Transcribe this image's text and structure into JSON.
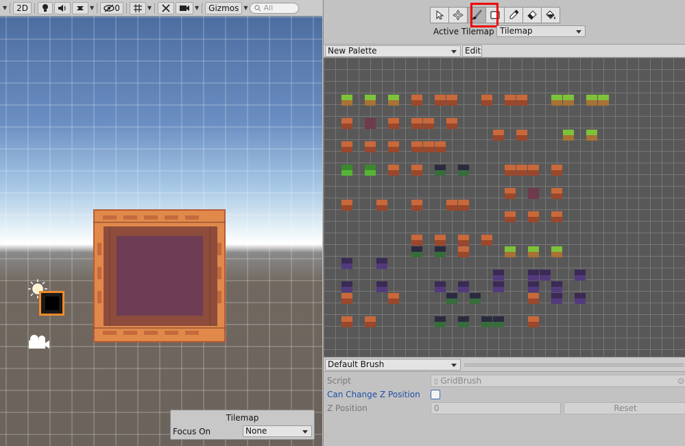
{
  "scene": {
    "toolbar": {
      "mode_2d_label": "2D",
      "hidden_count": "0",
      "gizmos_label": "Gizmos",
      "search_placeholder": "All",
      "icons": [
        "lightbulb-icon",
        "audio-icon",
        "effects-icon",
        "visibility-icon",
        "grid-icon",
        "tools-icon",
        "camera-icon"
      ]
    },
    "colors": {
      "sky_top": "#4d6da0",
      "ground": "#6a625b",
      "frame_orange": "#e0894a",
      "frame_interior": "#6e3c55"
    }
  },
  "tilemap_overlay": {
    "title": "Tilemap",
    "focus_label": "Focus On",
    "focus_value": "None"
  },
  "palette": {
    "tools": [
      {
        "name": "select-tool-icon",
        "tooltip": "Select"
      },
      {
        "name": "move-tool-icon",
        "tooltip": "Move"
      },
      {
        "name": "paint-brush-tool-icon",
        "tooltip": "Paint",
        "active": true
      },
      {
        "name": "box-fill-tool-icon",
        "tooltip": "Box Fill"
      },
      {
        "name": "picker-tool-icon",
        "tooltip": "Pick"
      },
      {
        "name": "eraser-tool-icon",
        "tooltip": "Erase"
      },
      {
        "name": "fill-tool-icon",
        "tooltip": "Fill"
      }
    ],
    "active_tilemap_label": "Active Tilemap",
    "active_tilemap_value": "Tilemap",
    "palette_name": "New Palette",
    "edit_label": "Edit",
    "highlight_color": "#ee0000"
  },
  "brush": {
    "name": "Default Brush",
    "script_label": "Script",
    "script_value": "GridBrush",
    "can_change_z_label": "Can Change Z Position",
    "can_change_z_checked": false,
    "z_position_label": "Z Position",
    "z_position_value": "0",
    "reset_label": "Reset"
  }
}
